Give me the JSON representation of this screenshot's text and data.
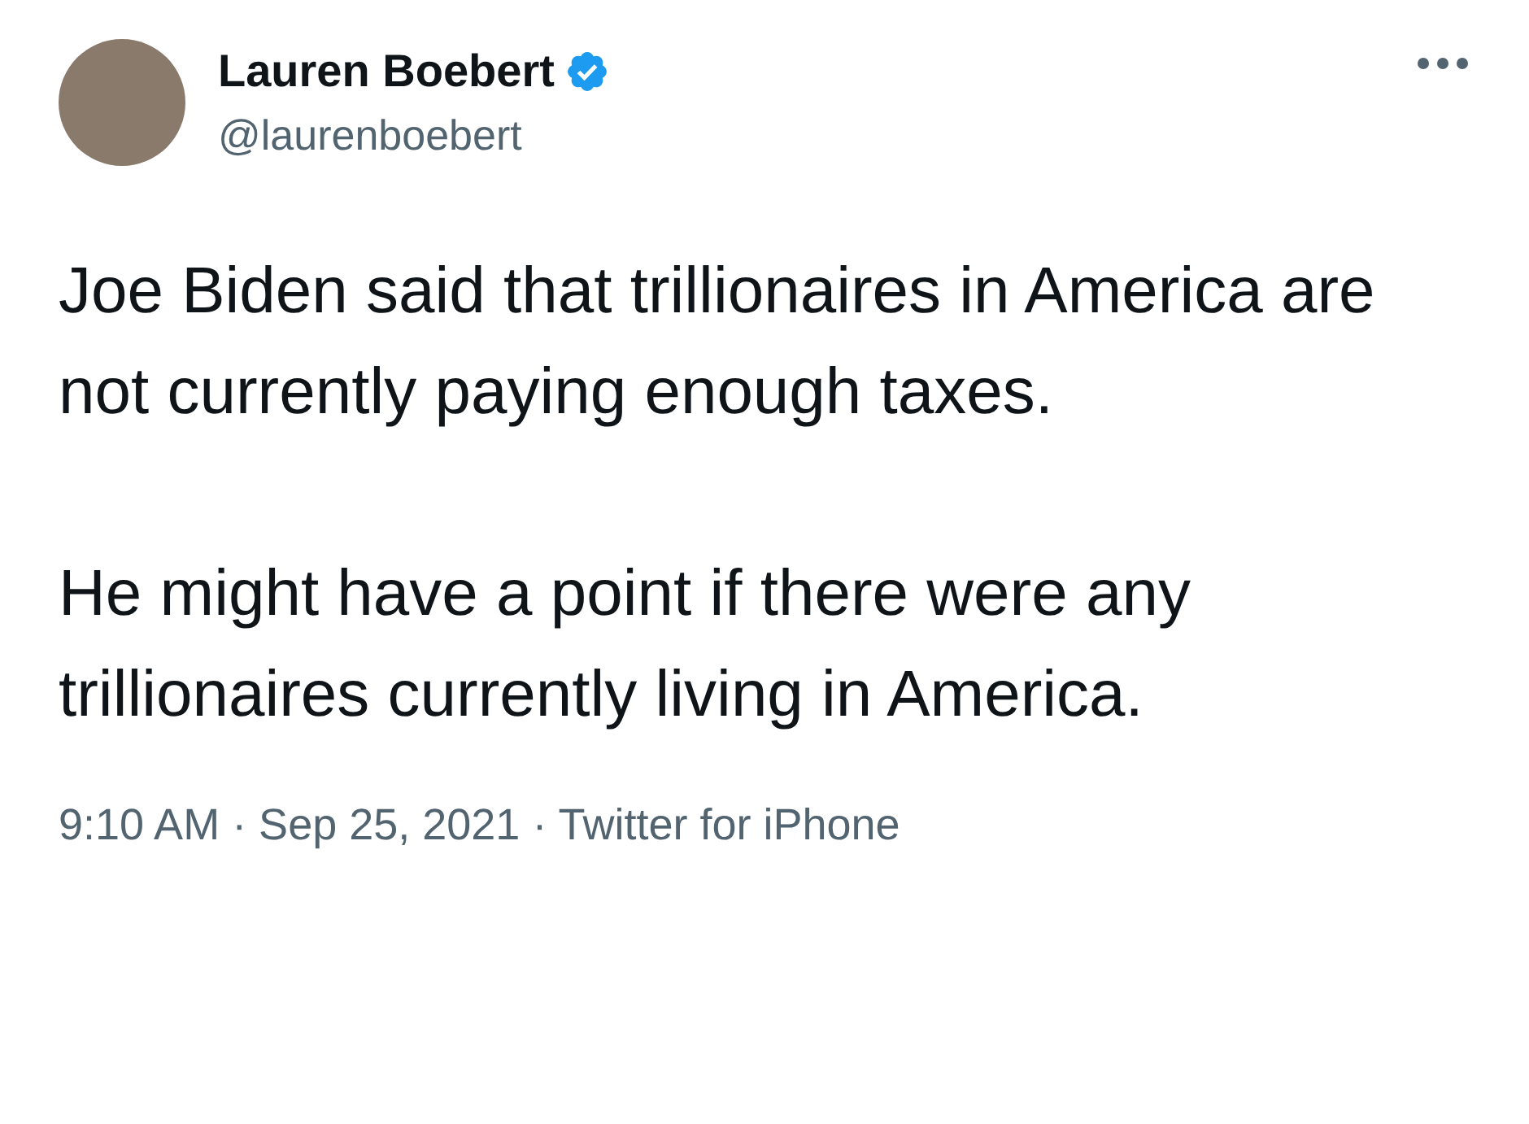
{
  "author": {
    "name": "Lauren Boebert",
    "verified": true,
    "handle": "@laurenboebert"
  },
  "paragraphs": [
    "Joe Biden said that trillionaires in America are not currently paying enough taxes.",
    "He might have a point if there were any trillionaires currently living in America."
  ],
  "meta": "9:10 AM · Sep 25, 2021 · Twitter for iPhone"
}
